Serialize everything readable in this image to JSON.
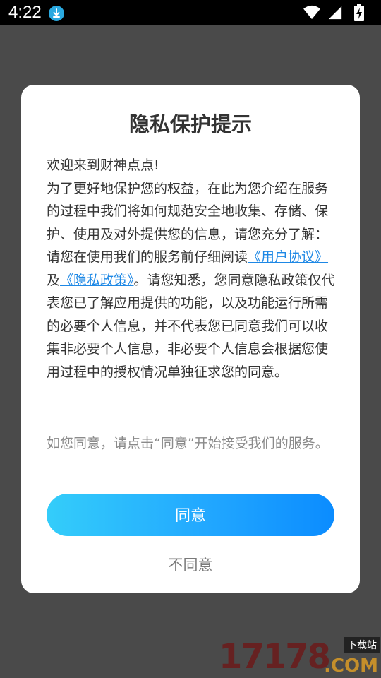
{
  "status_bar": {
    "time": "4:22",
    "icons": [
      "download-icon",
      "wifi-icon",
      "signal-icon",
      "battery-charging-icon"
    ]
  },
  "dialog": {
    "title": "隐私保护提示",
    "greeting": "欢迎来到财神点点!",
    "paragraph1": "为了更好地保护您的权益，在此为您介绍在服务的过程中我们将如何规范安全地收集、存储、保护、使用及对外提供您的信息，请您充分了解：",
    "paragraph2_pre": "请您在使用我们的服务前仔细阅读",
    "user_agreement_link": "《用户协议》",
    "and": "及",
    "privacy_policy_link": "《隐私政策》",
    "paragraph2_post": "。请您知悉，您同意隐私政策仅代表您已了解应用提供的功能，以及功能运行所需的必要个人信息，并不代表您已同意我们可以收集非必要个人信息，非必要个人信息会根据您使用过程中的授权情况单独征求您的同意。",
    "note": "如您同意，请点击“同意”开始接受我们的服务。",
    "agree_label": "同意",
    "disagree_label": "不同意"
  },
  "watermark": {
    "number": "17178",
    "tag": "下载站",
    "suffix": ".COM"
  },
  "colors": {
    "accent": "#1e88e5",
    "button_gradient_start": "#34cdfa",
    "button_gradient_end": "#0b8cff"
  }
}
